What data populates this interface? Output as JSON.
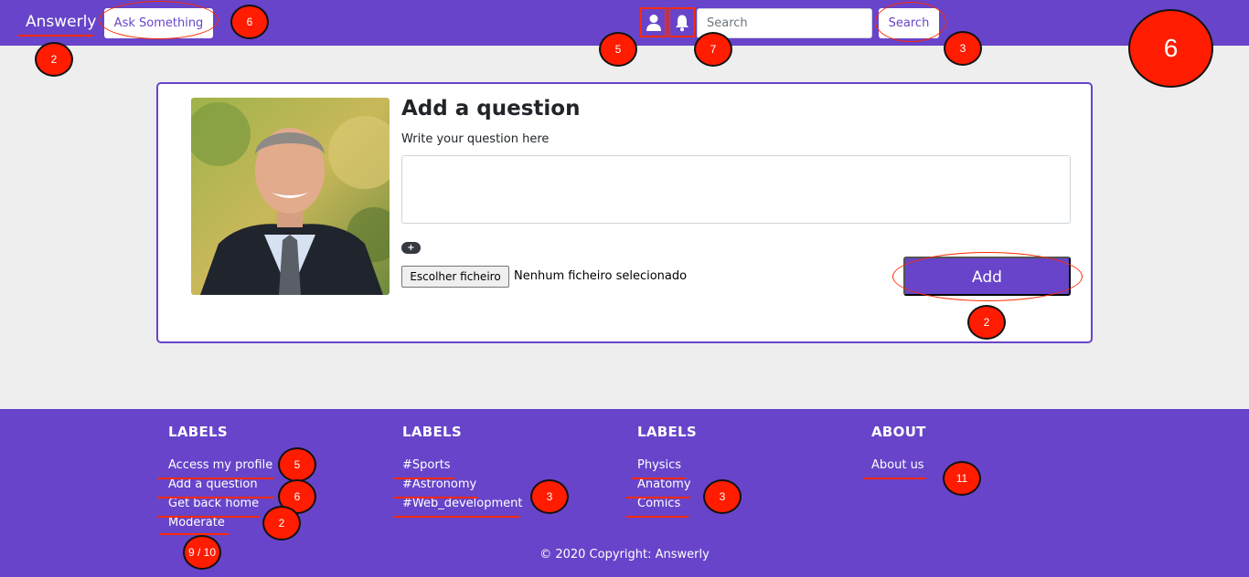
{
  "navbar": {
    "brand": "Answerly",
    "ask_label": "Ask Something",
    "user_icon": "user-icon",
    "bell_icon": "bell-icon",
    "search_placeholder": "Search",
    "search_value": "",
    "search_label": "Search"
  },
  "form": {
    "title": "Add a question",
    "subtitle": "Write your question here",
    "question_value": "",
    "plus_label": "+",
    "file_button_label": "Escolher ficheiro",
    "file_status": "Nenhum ficheiro selecionado",
    "add_label": "Add"
  },
  "footer": {
    "columns": [
      {
        "heading": "LABELS",
        "items": [
          "Access my profile",
          "Add a question",
          "Get back home",
          "Moderate"
        ]
      },
      {
        "heading": "LABELS",
        "items": [
          "#Sports",
          "#Astronomy",
          "#Web_development"
        ]
      },
      {
        "heading": "LABELS",
        "items": [
          "Physics",
          "Anatomy",
          "Comics"
        ]
      },
      {
        "heading": "ABOUT",
        "items": [
          "About us"
        ]
      }
    ],
    "copyright": "© 2020 Copyright: Answerly"
  },
  "annotations": {
    "brand": "2",
    "ask": "6",
    "user": "5",
    "bell": "7",
    "search": "3",
    "overall": "6",
    "add": "2",
    "profile": "5",
    "add_question": "6",
    "get_back_home": "2",
    "moderate": "9 / 10",
    "labels_col2": "3",
    "labels_col3": "3",
    "about_us": "11"
  },
  "colors": {
    "primary": "#6744c9",
    "background": "#eeeeee",
    "annotation_red": "#ff1c00"
  }
}
